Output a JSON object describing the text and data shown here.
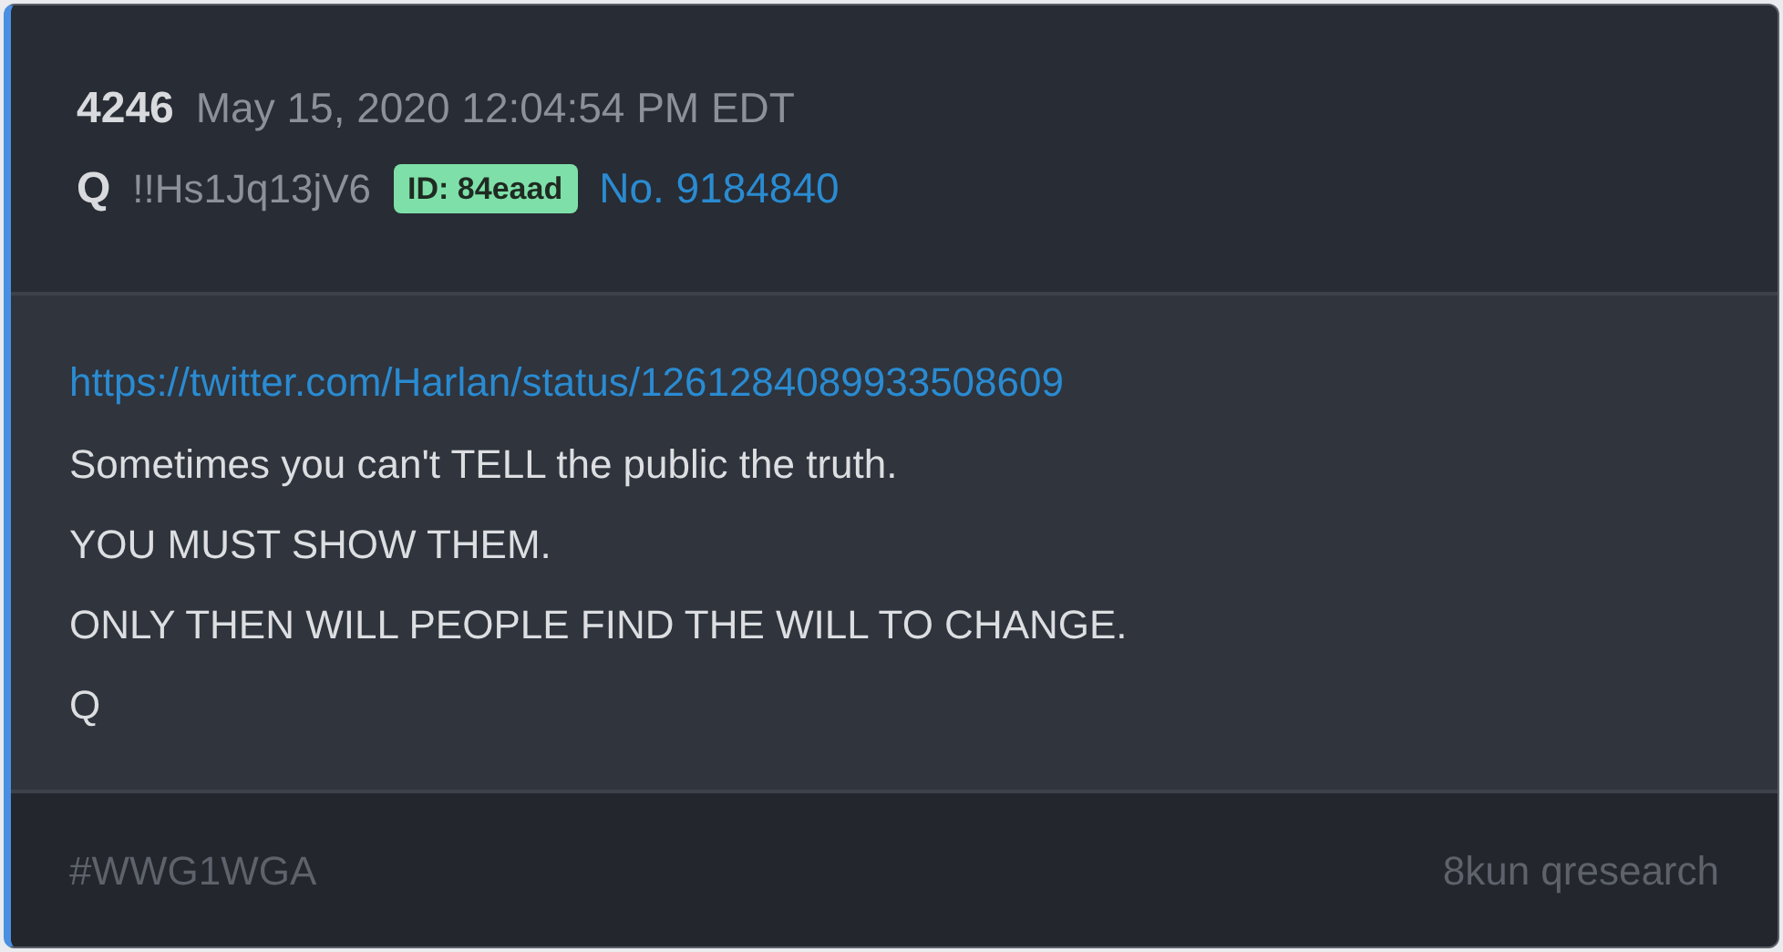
{
  "header": {
    "drop_number": "4246",
    "timestamp": "May 15, 2020 12:04:54 PM EDT",
    "author": "Q",
    "tripcode": "!!Hs1Jq13jV6",
    "id_badge": "ID: 84eaad",
    "post_number": "No. 9184840"
  },
  "body": [
    {
      "kind": "link",
      "text": "https://twitter.com/Harlan/status/1261284089933508609"
    },
    {
      "kind": "text",
      "text": "Sometimes you can't TELL the public the truth."
    },
    {
      "kind": "text",
      "text": "YOU MUST SHOW THEM."
    },
    {
      "kind": "text",
      "text": "ONLY THEN WILL PEOPLE FIND THE WILL TO CHANGE."
    },
    {
      "kind": "text",
      "text": "Q"
    }
  ],
  "footer": {
    "hashtag": "#WWG1WGA",
    "source": "8kun qresearch"
  }
}
